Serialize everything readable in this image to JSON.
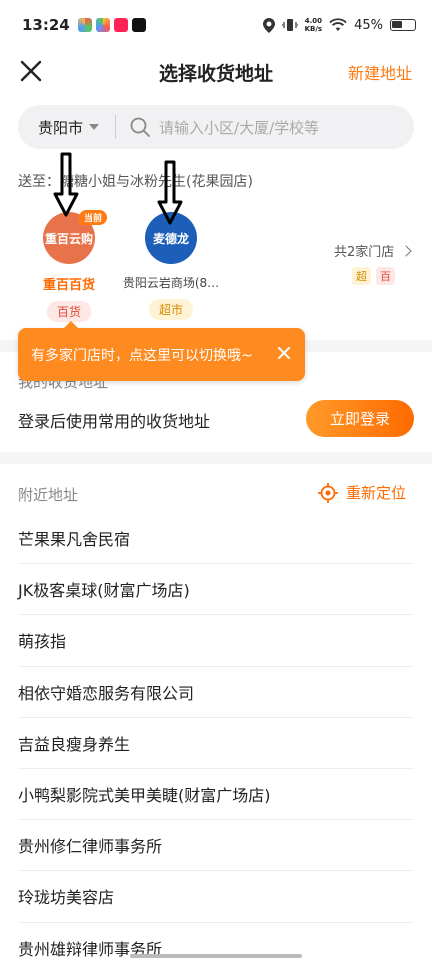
{
  "status_bar": {
    "time": "13:24",
    "net_speed_value": "4.00",
    "net_speed_unit": "KB/s",
    "battery": "45%"
  },
  "header": {
    "title": "选择收货地址",
    "new_address": "新建地址"
  },
  "search": {
    "city": "贵阳市",
    "placeholder": "请输入小区/大厦/学校等"
  },
  "delivery": {
    "deliver_to": "送至：糖糖小姐与冰粉先生(花果园店)",
    "stores": [
      {
        "logo_text": "重百云购",
        "name": "重百百货",
        "tag": "百货",
        "badge": "当前",
        "color": "#e8734a"
      },
      {
        "logo_text": "麦德龙",
        "name": "贵阳云岩商场(8…",
        "tag": "超市",
        "color": "#1d5fb8"
      }
    ],
    "store_count": "共2家门店",
    "mini_tags": [
      "超",
      "百"
    ]
  },
  "tooltip": {
    "text": "有多家门店时，点这里可以切换哦~"
  },
  "my_addresses": {
    "title": "我的收货地址",
    "login_hint": "登录后使用常用的收货地址",
    "login_button": "立即登录"
  },
  "nearby": {
    "title": "附近地址",
    "relocate": "重新定位",
    "items": [
      "芒果果凡舍民宿",
      "JK极客桌球(财富广场店)",
      "萌孩指",
      "相依守婚恋服务有限公司",
      "吉益良瘦身养生",
      "小鸭梨影院式美甲美睫(财富广场店)",
      "贵州修仁律师事务所",
      "玲珑坊美容店",
      "贵州雄辩律师事务所"
    ]
  },
  "colors": {
    "accent": "#ff6a00",
    "tooltip": "#ff8a1f"
  }
}
